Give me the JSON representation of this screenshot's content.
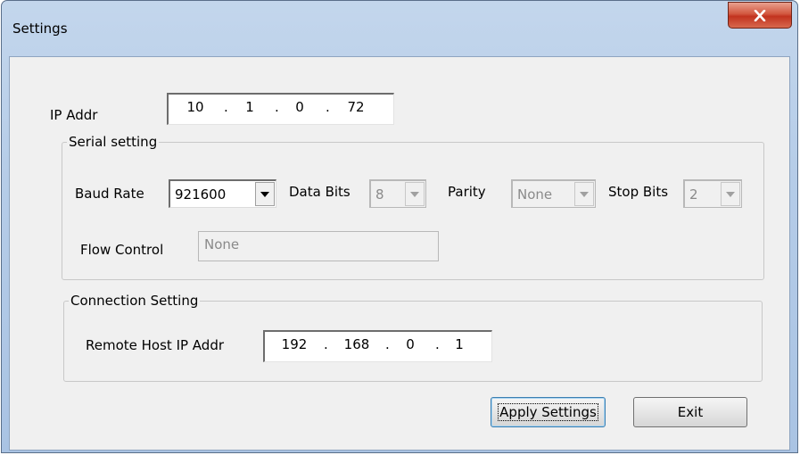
{
  "window": {
    "title": "Settings",
    "close_label": "X"
  },
  "ip_addr": {
    "label": "IP Addr",
    "octets": [
      "10",
      "1",
      "0",
      "72"
    ]
  },
  "serial": {
    "legend": "Serial setting",
    "baud_rate": {
      "label": "Baud Rate",
      "value": "921600",
      "enabled": true
    },
    "data_bits": {
      "label": "Data Bits",
      "value": "8",
      "enabled": false
    },
    "parity": {
      "label": "Parity",
      "value": "None",
      "enabled": false
    },
    "stop_bits": {
      "label": "Stop Bits",
      "value": "2",
      "enabled": false
    },
    "flow_control": {
      "label": "Flow Control",
      "value": "None",
      "enabled": false
    }
  },
  "connection": {
    "legend": "Connection Setting",
    "remote_host": {
      "label": "Remote Host IP Addr",
      "octets": [
        "192",
        "168",
        "0",
        "1"
      ]
    }
  },
  "buttons": {
    "apply": "Apply Settings",
    "exit": "Exit"
  },
  "colors": {
    "close_button": "#c2331f",
    "frame": "#b5cce8",
    "client": "#f0f0f0"
  },
  "icons": {
    "close": "close-icon",
    "dropdown": "chevron-down-icon"
  }
}
